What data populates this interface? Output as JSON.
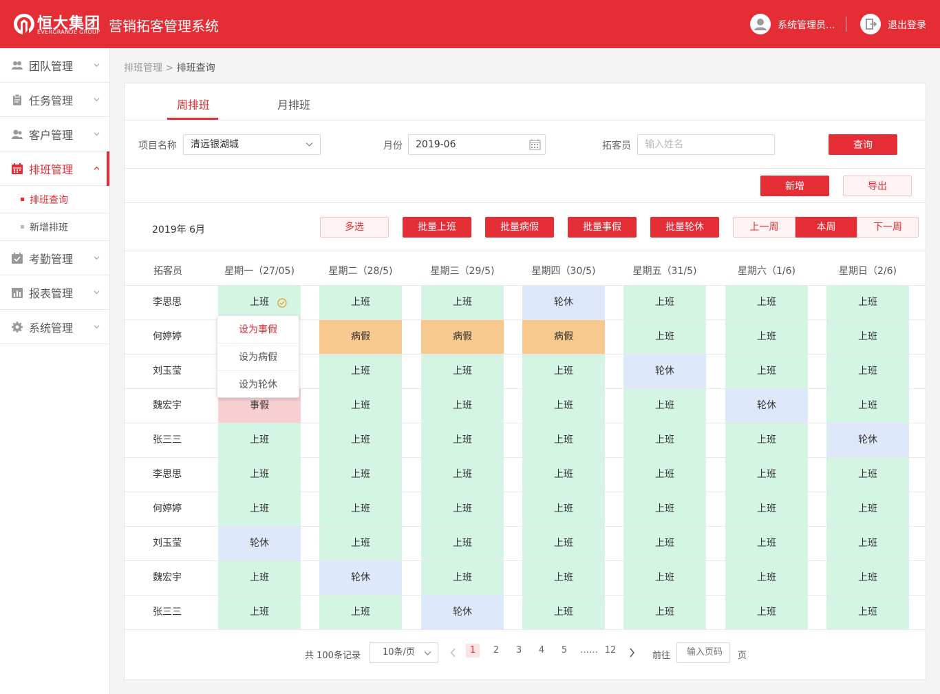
{
  "header": {
    "logo_cn": "恒大集团",
    "logo_en": "EVERGRANDE GROUP",
    "app_title": "营销拓客管理系统",
    "user_name": "系统管理员...",
    "logout": "退出登录"
  },
  "sidebar": {
    "items": [
      {
        "label": "团队管理",
        "icon": "team-icon"
      },
      {
        "label": "任务管理",
        "icon": "clipboard-icon"
      },
      {
        "label": "客户管理",
        "icon": "users-icon"
      },
      {
        "label": "排班管理",
        "icon": "calendar-icon"
      },
      {
        "label": "考勤管理",
        "icon": "check-calendar-icon"
      },
      {
        "label": "报表管理",
        "icon": "chart-icon"
      },
      {
        "label": "系统管理",
        "icon": "gear-icon"
      }
    ],
    "subitems": [
      {
        "label": "排班查询"
      },
      {
        "label": "新增排班"
      }
    ]
  },
  "breadcrumb": {
    "parent": "排班管理",
    "sep": ">",
    "current": "排班查询"
  },
  "tabs": {
    "weekly": "周排班",
    "monthly": "月排班"
  },
  "filters": {
    "project_label": "项目名称",
    "project_value": "清远银湖城",
    "month_label": "月份",
    "month_value": "2019-06",
    "staff_label": "拓客员",
    "staff_placeholder": "输入姓名",
    "search_button": "查询"
  },
  "actions": {
    "add": "新增",
    "export": "导出"
  },
  "week_bar": {
    "month_text": "2019年 6月",
    "multi_select": "多选",
    "batch_work": "批量上班",
    "batch_sick": "批量病假",
    "batch_leave": "批量事假",
    "batch_rest": "批量轮休",
    "prev_week": "上一周",
    "this_week": "本周",
    "next_week": "下一周"
  },
  "table": {
    "headers": [
      "拓客员",
      "星期一（27/05)",
      "星期二（28/5)",
      "星期三（29/5)",
      "星期四（30/5)",
      "星期五（31/5)",
      "星期六（1/6)",
      "星期日（2/6)"
    ],
    "rows": [
      {
        "name": "李思思",
        "cells": [
          "上班",
          "上班",
          "上班",
          "轮休",
          "上班",
          "上班",
          "上班"
        ]
      },
      {
        "name": "何婷婷",
        "cells": [
          "",
          "病假",
          "病假",
          "病假",
          "上班",
          "上班",
          "上班"
        ]
      },
      {
        "name": "刘玉莹",
        "cells": [
          "",
          "上班",
          "上班",
          "上班",
          "轮休",
          "上班",
          "上班"
        ]
      },
      {
        "name": "魏宏宇",
        "cells": [
          "事假",
          "上班",
          "上班",
          "上班",
          "上班",
          "轮休",
          "上班"
        ]
      },
      {
        "name": "张三三",
        "cells": [
          "上班",
          "上班",
          "上班",
          "上班",
          "上班",
          "上班",
          "轮休"
        ]
      },
      {
        "name": "李思思",
        "cells": [
          "上班",
          "上班",
          "上班",
          "上班",
          "上班",
          "上班",
          "上班"
        ]
      },
      {
        "name": "何婷婷",
        "cells": [
          "上班",
          "上班",
          "上班",
          "上班",
          "上班",
          "上班",
          "上班"
        ]
      },
      {
        "name": "刘玉莹",
        "cells": [
          "轮休",
          "上班",
          "上班",
          "上班",
          "上班",
          "上班",
          "上班"
        ]
      },
      {
        "name": "魏宏宇",
        "cells": [
          "上班",
          "轮休",
          "上班",
          "上班",
          "上班",
          "上班",
          "上班"
        ]
      },
      {
        "name": "张三三",
        "cells": [
          "上班",
          "上班",
          "轮休",
          "上班",
          "上班",
          "上班",
          "上班"
        ]
      }
    ],
    "status_colors": {
      "上班": "#d4f5e3",
      "病假": "#f8c98f",
      "事假": "#f7cfd1",
      "轮休": "#dde9fb"
    }
  },
  "popup": {
    "items": [
      "设为事假",
      "设为病假",
      "设为轮休"
    ]
  },
  "pagination": {
    "total_text": "共 100条记录",
    "page_size": "10条/页",
    "pages": [
      "1",
      "2",
      "3",
      "4",
      "5",
      "……",
      "12"
    ],
    "goto_label": "前往",
    "goto_placeholder": "输入页码",
    "page_suffix": "页"
  },
  "colors": {
    "brand": "#e52d35"
  }
}
